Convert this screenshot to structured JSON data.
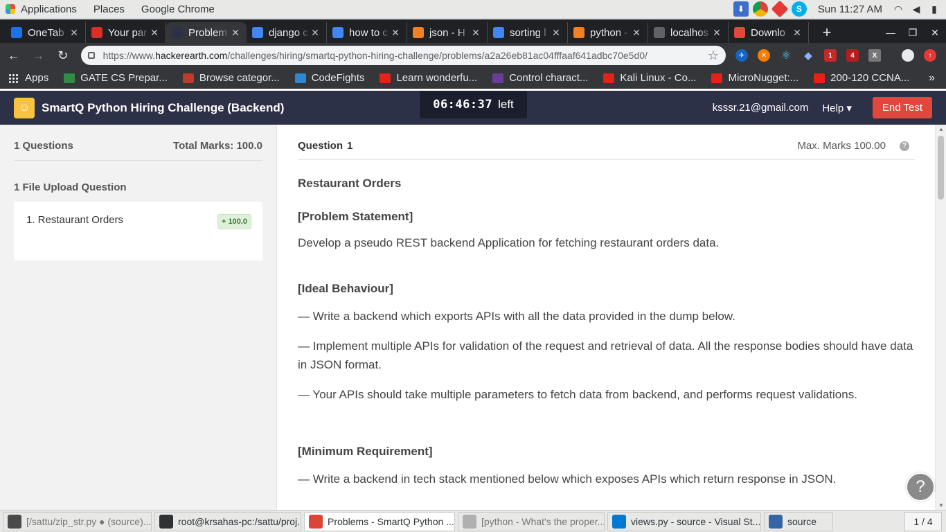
{
  "gnome": {
    "menu": [
      "Applications",
      "Places",
      "Google Chrome"
    ],
    "clock": "Sun 11:27 AM"
  },
  "tabs": [
    {
      "title": "OneTab",
      "favicon": "gem-icon",
      "color": "#1a73e8"
    },
    {
      "title": "Your par",
      "favicon": "gmail-icon",
      "color": "#d93025"
    },
    {
      "title": "Problem",
      "favicon": "hackerearth-icon",
      "color": "#2d3147",
      "active": true
    },
    {
      "title": "django c",
      "favicon": "google-icon",
      "color": "#4285f4"
    },
    {
      "title": "how to c",
      "favicon": "google-icon",
      "color": "#4285f4"
    },
    {
      "title": "json - H",
      "favicon": "stackoverflow-icon",
      "color": "#f48024"
    },
    {
      "title": "sorting l",
      "favicon": "google-icon",
      "color": "#4285f4"
    },
    {
      "title": "python -",
      "favicon": "stackoverflow-icon",
      "color": "#f48024"
    },
    {
      "title": "localhos",
      "favicon": "globe-icon",
      "color": "#5f6368"
    },
    {
      "title": "Downlo",
      "favicon": "g-icon",
      "color": "#e0483e"
    }
  ],
  "url": {
    "scheme": "https://www.",
    "host": "hackerearth.com",
    "path": "/challenges/hiring/smartq-python-hiring-challenge/problems/a2a26eb81ac04fffaaf641adbc70e5d0/"
  },
  "bookmarks": [
    {
      "label": "Apps",
      "icon": "apps-grid-icon"
    },
    {
      "label": "GATE CS Prepar...",
      "icon": "geeksforgeeks-icon",
      "color": "#2f8d46"
    },
    {
      "label": "Browse categor...",
      "icon": "question-icon",
      "color": "#c0392b"
    },
    {
      "label": "CodeFights",
      "icon": "codefights-icon",
      "color": "#2a88d4"
    },
    {
      "label": "Learn wonderfu...",
      "icon": "youtube-icon",
      "color": "#e62117"
    },
    {
      "label": "Control charact...",
      "icon": "ut-icon",
      "color": "#6a3d9a"
    },
    {
      "label": "Kali Linux - Co...",
      "icon": "youtube-icon",
      "color": "#e62117"
    },
    {
      "label": "MicroNugget:...",
      "icon": "youtube-icon",
      "color": "#e62117"
    },
    {
      "label": "200-120 CCNA...",
      "icon": "youtube-icon",
      "color": "#e62117"
    }
  ],
  "he": {
    "title": "SmartQ Python Hiring Challenge (Backend)",
    "timer": "06:46:37",
    "timer_suffix": "left",
    "email": "ksssr.21@gmail.com",
    "help": "Help ▾",
    "end_test": "End Test"
  },
  "sidebar": {
    "questions_count": "1 Questions",
    "total_marks": "Total Marks: 100.0",
    "section": "1 File Upload Question",
    "question_item": "1. Restaurant Orders",
    "question_badge": "+ 100.0"
  },
  "question": {
    "label": "Question",
    "number": "1",
    "max_marks": "Max. Marks 100.00",
    "title": "Restaurant Orders",
    "problem_heading": "[Problem Statement]",
    "problem_text": "Develop a pseudo REST backend Application for fetching restaurant orders data.",
    "ideal_heading": "[Ideal Behaviour]",
    "ideal_1": "— Write a backend which exports APIs with all the data provided in the dump below.",
    "ideal_2": "— Implement multiple APIs for validation of the request and retrieval of data. All the response bodies should have data in JSON format.",
    "ideal_3": "— Your APIs should take multiple parameters to fetch data from backend, and performs request validations.",
    "min_heading": "[Minimum Requirement]",
    "min_1": "— Write a backend in tech stack mentioned below which exposes APIs which return response in JSON."
  },
  "taskbar": {
    "items": [
      {
        "label": "[/sattu/zip_str.py ● (source)...",
        "icon": "sublime-icon",
        "color": "#4b4b4b",
        "dim": true
      },
      {
        "label": "root@krsahas-pc:/sattu/proj...",
        "icon": "terminal-icon",
        "color": "#2e3436"
      },
      {
        "label": "Problems - SmartQ Python ...",
        "icon": "chrome-icon",
        "color": "#db4437",
        "active": true
      },
      {
        "label": "[python - What's the proper...",
        "icon": "chrome-icon",
        "color": "#b0b0b0",
        "dim": true
      },
      {
        "label": "views.py - source - Visual St...",
        "icon": "vscode-icon",
        "color": "#0078d4"
      },
      {
        "label": "source",
        "icon": "folder-icon",
        "color": "#3465a4"
      }
    ],
    "pager": "1 / 4"
  }
}
